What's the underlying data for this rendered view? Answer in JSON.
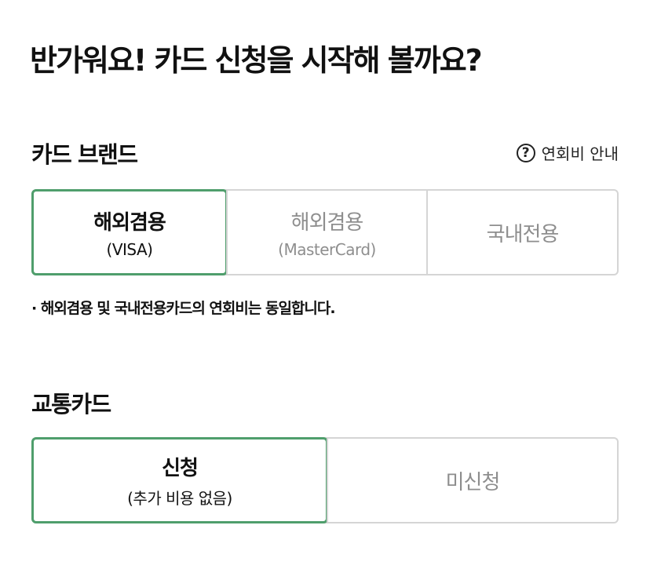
{
  "header": {
    "title": "반가워요!  카드 신청을 시작해 볼까요?"
  },
  "card_brand": {
    "label": "카드 브랜드",
    "fee_guide": {
      "icon": "question-circle-icon",
      "label": "연회비 안내"
    },
    "options": [
      {
        "main": "해외겸용",
        "sub": "(VISA)",
        "selected": true
      },
      {
        "main": "해외겸용",
        "sub": "(MasterCard)",
        "selected": false
      },
      {
        "main": "국내전용",
        "sub": "",
        "selected": false
      }
    ],
    "note": "· 해외겸용 및 국내전용카드의 연회비는 동일합니다."
  },
  "transit_card": {
    "label": "교통카드",
    "options": [
      {
        "main": "신청",
        "sub": "(추가 비용 없음)",
        "selected": true
      },
      {
        "main": "미신청",
        "sub": "",
        "selected": false
      }
    ]
  },
  "colors": {
    "selected_border": "#4f9e6c",
    "unselected_text": "#8e8e8e",
    "border": "#d5d5d5"
  }
}
